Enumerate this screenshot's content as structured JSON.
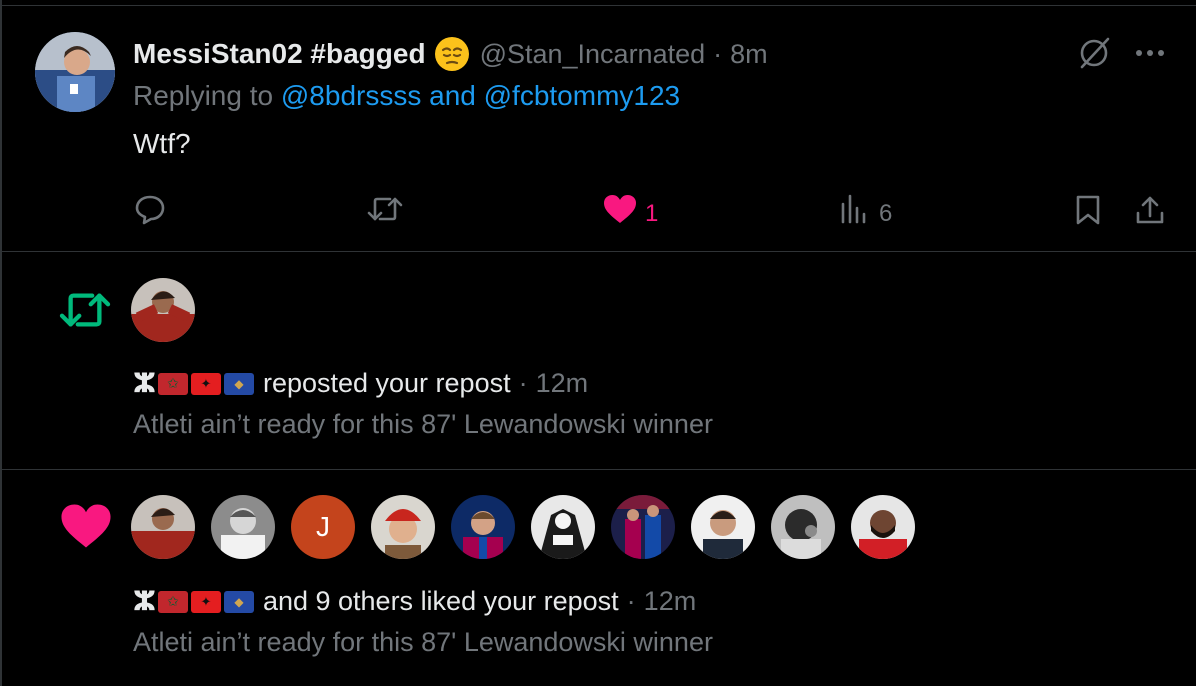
{
  "tweet": {
    "display_name": "MessiStan02 #bagged",
    "emoji": "pensive-face-emoji",
    "handle": "@Stan_Incarnated",
    "separator": "·",
    "time": "8m",
    "replying_prefix": "Replying to",
    "replying_to": "@8bdrssss and @fcbtommy123",
    "text": "Wtf?",
    "actions": {
      "reply_icon": "reply-icon",
      "repost_icon": "repost-icon",
      "like_icon": "heart-filled-icon",
      "like_count": "1",
      "views_icon": "views-icon",
      "views_count": "6",
      "bookmark_icon": "bookmark-icon",
      "share_icon": "share-icon"
    },
    "top_right_icons": [
      "grok-icon",
      "more-icon"
    ]
  },
  "repost_notification": {
    "icon": "repost-icon",
    "name_glyph": "ⵣ",
    "flags": [
      "morocco-flag",
      "albania-flag",
      "kosovo-flag"
    ],
    "action_text": "reposted your repost",
    "separator": "·",
    "time": "12m",
    "quote": "Atleti ain’t ready for this 87' Lewandowski winner"
  },
  "like_notification": {
    "icon": "heart-filled-icon",
    "avatar_initial": "J",
    "name_glyph": "ⵣ",
    "flags": [
      "morocco-flag",
      "albania-flag",
      "kosovo-flag"
    ],
    "action_text": "and 9 others liked your repost",
    "separator": "·",
    "time": "12m",
    "quote": "Atleti ain’t ready for this 87' Lewandowski winner"
  },
  "colors": {
    "background": "#000000",
    "divider": "#2f3336",
    "text": "#e7e9ea",
    "muted": "#71767b",
    "link": "#1d9bf0",
    "like": "#f91880",
    "repost": "#00ba7c"
  }
}
